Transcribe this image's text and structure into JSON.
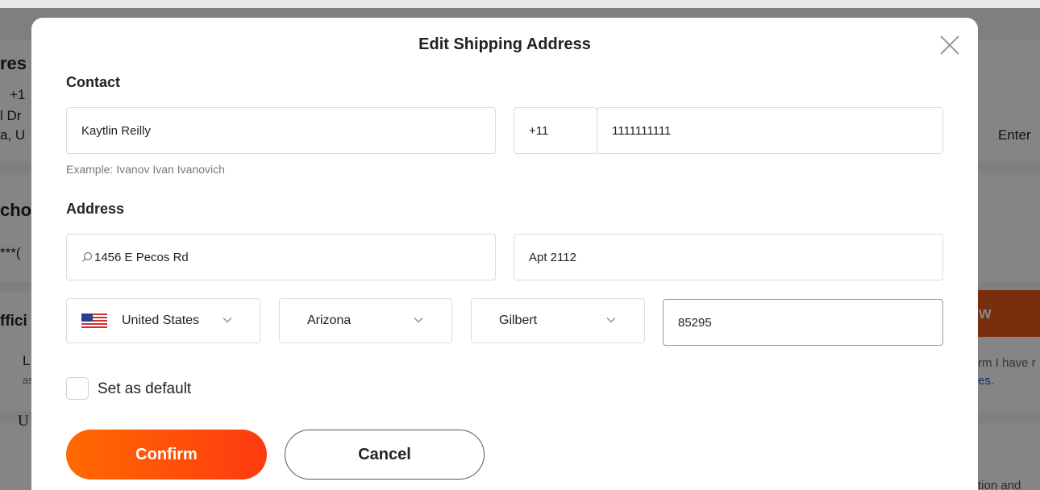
{
  "background": {
    "left_fragments": [
      "res",
      "+1",
      "l Dr",
      "a, U",
      "cho",
      "***(",
      "ffici",
      "L",
      "as",
      "U"
    ],
    "right_fragments": [
      "Enter",
      "w",
      "rm I have r",
      "es.",
      "tion and"
    ]
  },
  "modal": {
    "title": "Edit Shipping Address",
    "contact_label": "Contact",
    "address_label": "Address",
    "name_value": "Kaytlin Reilly",
    "phone_code": "+11",
    "phone_value": "1111111111",
    "name_hint": "Example: Ivanov Ivan Ivanovich",
    "street_value": "1456 E Pecos Rd",
    "apt_value": "Apt 2112",
    "country": "United States",
    "state": "Arizona",
    "city": "Gilbert",
    "zip_value": "85295",
    "default_label": "Set as default",
    "confirm_label": "Confirm",
    "cancel_label": "Cancel"
  },
  "colors": {
    "accent_start": "#ff6a00",
    "accent_end": "#fe3a10",
    "overlay": "rgba(0,0,0,0.48)",
    "link": "#1a5fd0"
  }
}
